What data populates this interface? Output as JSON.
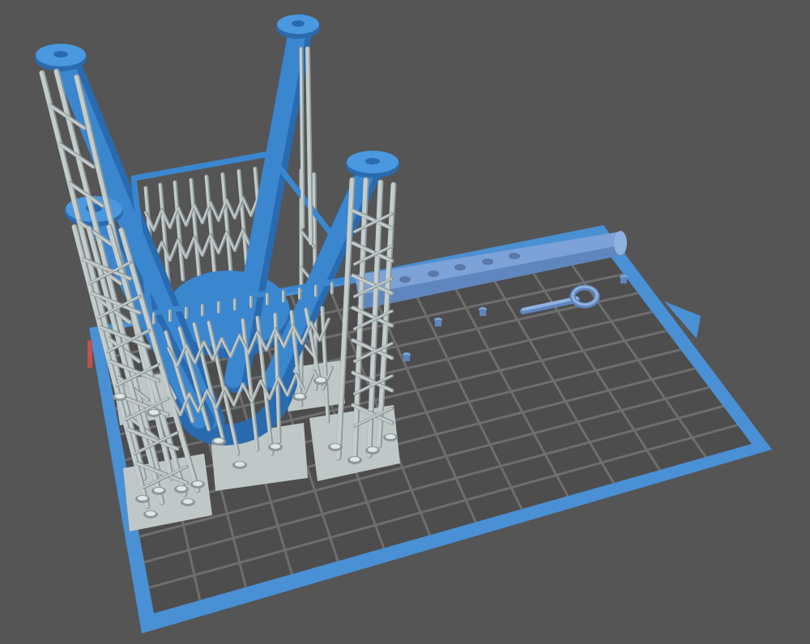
{
  "viewport": {
    "background": "#555555",
    "colors": {
      "bed_frame": "#4a90d4",
      "bed_surface": "#4d4d4d",
      "grid_line": "#6e6e6e",
      "model": "#3a87d0",
      "model_dark": "#2a6aae",
      "model_light": "#63a6e3",
      "support": "#c4cdcd",
      "support_dark": "#8e9898",
      "raft": "#bfc7c7",
      "rod": "#7da2d8",
      "rod_dark": "#5f86be",
      "bed_edge_marker": "#c0504d"
    },
    "icons": [
      "build-plate",
      "support-structure",
      "model-part",
      "rod-part",
      "eye-bolt-part"
    ]
  }
}
